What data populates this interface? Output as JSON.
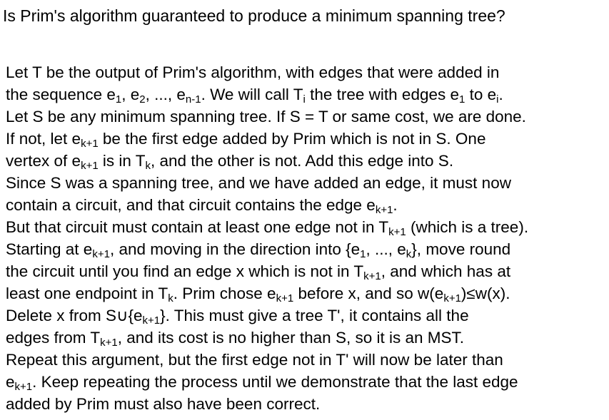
{
  "title": "Is Prim's algorithm guaranteed to produce a minimum spanning tree?",
  "lines": [
    [
      {
        "t": "Let T be the output of Prim's algorithm, with edges that were added in"
      }
    ],
    [
      {
        "t": "the sequence e"
      },
      {
        "s": "1"
      },
      {
        "t": ", e"
      },
      {
        "s": "2"
      },
      {
        "t": ", ..., e"
      },
      {
        "s": "n-1"
      },
      {
        "t": ". We will call T"
      },
      {
        "s": "i"
      },
      {
        "t": " the tree with edges e"
      },
      {
        "s": "1"
      },
      {
        "t": " to e"
      },
      {
        "s": "i"
      },
      {
        "t": "."
      }
    ],
    [
      {
        "t": "Let S be any minimum spanning tree. If S = T or same cost, we are done."
      }
    ],
    [
      {
        "t": "If not, let  e"
      },
      {
        "s": "k+1"
      },
      {
        "t": " be the first edge added by Prim which is not in S. One"
      }
    ],
    [
      {
        "t": "vertex of  e"
      },
      {
        "s": "k+1"
      },
      {
        "t": " is in T"
      },
      {
        "s": "k"
      },
      {
        "t": ", and the other is not. Add this edge into S."
      }
    ],
    [
      {
        "t": "Since S was a spanning tree, and we have added an edge, it must now"
      }
    ],
    [
      {
        "t": "contain a circuit, and that circuit contains the edge e"
      },
      {
        "s": "k+1"
      },
      {
        "t": "."
      }
    ],
    [
      {
        "t": "But that circuit must contain at least one edge not in T"
      },
      {
        "s": "k+1"
      },
      {
        "t": " (which is a tree)."
      }
    ],
    [
      {
        "t": "Starting at e"
      },
      {
        "s": "k+1"
      },
      {
        "t": ", and moving in the direction into {e"
      },
      {
        "s": "1"
      },
      {
        "t": ", ..., e"
      },
      {
        "s": "k"
      },
      {
        "t": "}, move round"
      }
    ],
    [
      {
        "t": "the circuit until you find an edge x which is not in T"
      },
      {
        "s": "k+1"
      },
      {
        "t": ", and which has at"
      }
    ],
    [
      {
        "t": "least one endpoint in T"
      },
      {
        "s": "k"
      },
      {
        "t": ". Prim chose e"
      },
      {
        "s": "k+1"
      },
      {
        "t": " before x, and so w(e"
      },
      {
        "s": "k+1"
      },
      {
        "t": ")≤w(x)."
      }
    ],
    [
      {
        "t": "Delete x from S∪{e"
      },
      {
        "s": "k+1"
      },
      {
        "t": "}. This must give a tree T', it contains all the"
      }
    ],
    [
      {
        "t": "edges from T"
      },
      {
        "s": "k+1"
      },
      {
        "t": ", and its cost is no higher than S, so it is an MST."
      }
    ],
    [
      {
        "t": "Repeat this argument, but the first edge not in T' will now be later than"
      }
    ],
    [
      {
        "t": "e"
      },
      {
        "s": "k+1"
      },
      {
        "t": ". Keep repeating the process until we demonstrate that the last edge"
      }
    ],
    [
      {
        "t": "added by Prim must also have been correct."
      }
    ]
  ]
}
